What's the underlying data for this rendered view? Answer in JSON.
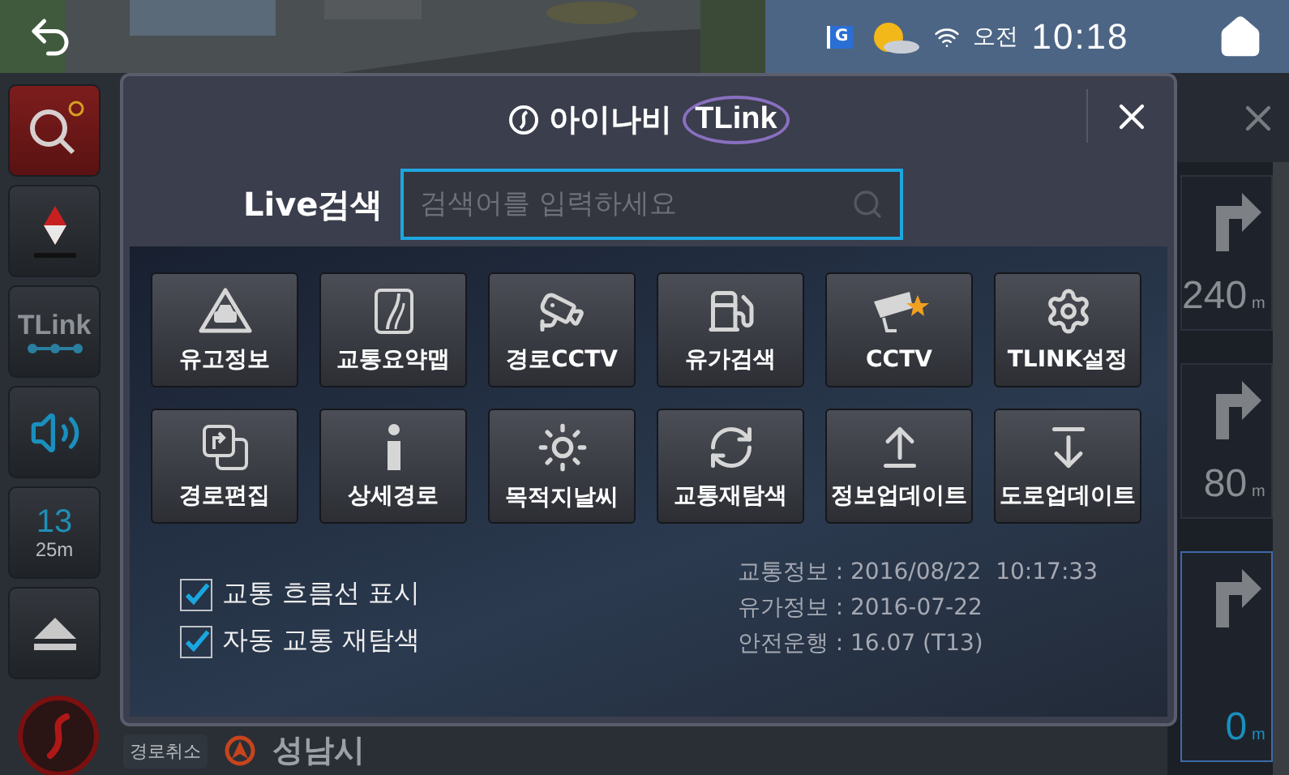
{
  "top_bar": {
    "status": {
      "flag_label": "G",
      "period": "오전",
      "time": "10:18"
    }
  },
  "left_rail": {
    "buttons": [
      {
        "kind": "search"
      },
      {
        "kind": "compass"
      },
      {
        "kind": "tlink",
        "label": "TLink"
      },
      {
        "kind": "sound"
      },
      {
        "kind": "distance",
        "label": "13",
        "sub": "25m"
      },
      {
        "kind": "eject"
      }
    ]
  },
  "guidance": {
    "cards": [
      {
        "distance": "240",
        "unit": "m",
        "selected": false
      },
      {
        "distance": "80",
        "unit": "m",
        "selected": false
      },
      {
        "distance": "0",
        "unit": "m",
        "selected": true
      }
    ]
  },
  "bottom_bar": {
    "cancel_label": "경로취소",
    "place": "성남시"
  },
  "dialog": {
    "logo": {
      "brand": "아이나비",
      "product": "TLink"
    },
    "search": {
      "label": "Live검색",
      "placeholder": "검색어를 입력하세요"
    },
    "menu": [
      {
        "label": "유고정보",
        "kind": "incident"
      },
      {
        "label": "교통요약맵",
        "kind": "roadmap"
      },
      {
        "label": "경로CCTV",
        "kind": "cctv"
      },
      {
        "label": "유가검색",
        "kind": "fuel"
      },
      {
        "label": "CCTV",
        "kind": "cctvstar"
      },
      {
        "label": "TLINK설정",
        "kind": "gear"
      },
      {
        "label": "경로편집",
        "kind": "routeedit"
      },
      {
        "label": "상세경로",
        "kind": "info"
      },
      {
        "label": "목적지날씨",
        "kind": "sun"
      },
      {
        "label": "교통재탐색",
        "kind": "refresh"
      },
      {
        "label": "정보업데이트",
        "kind": "upload"
      },
      {
        "label": "도로업데이트",
        "kind": "download"
      }
    ],
    "options": [
      {
        "label": "교통 흐름선 표시",
        "checked": true
      },
      {
        "label": "자동 교통 재탐색",
        "checked": true
      }
    ],
    "info": [
      "교통정보 : 2016/08/22  10:17:33",
      "유가정보 : 2016-07-22",
      "안전운행 : 16.07 (T13)"
    ]
  }
}
